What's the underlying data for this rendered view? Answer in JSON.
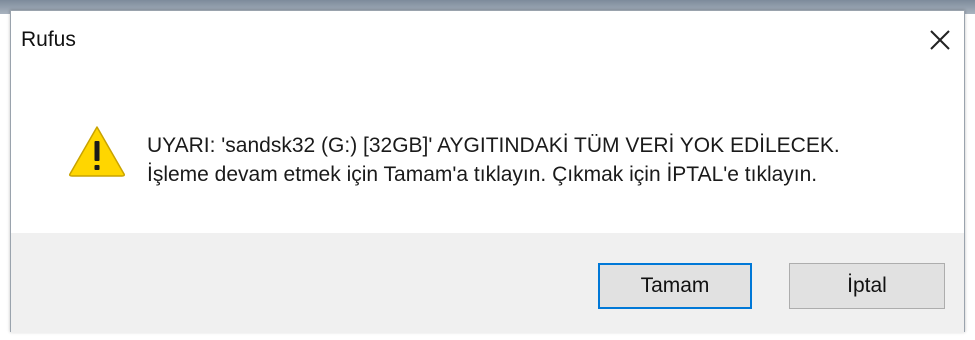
{
  "window": {
    "title": "Rufus",
    "close_icon": "close-icon"
  },
  "message": {
    "icon": "warning-icon",
    "line1": "UYARI: 'sandsk32 (G:) [32GB]' AYGITINDAKİ TÜM VERİ YOK EDİLECEK.",
    "line2": "İşleme devam etmek için Tamam'a tıklayın. Çıkmak için İPTAL'e tıklayın."
  },
  "buttons": {
    "ok_label": "Tamam",
    "cancel_label": "İptal"
  },
  "colors": {
    "accent_focus": "#0078d7",
    "warning_fill": "#ffd600",
    "footer_bg": "#f0f0f0"
  }
}
